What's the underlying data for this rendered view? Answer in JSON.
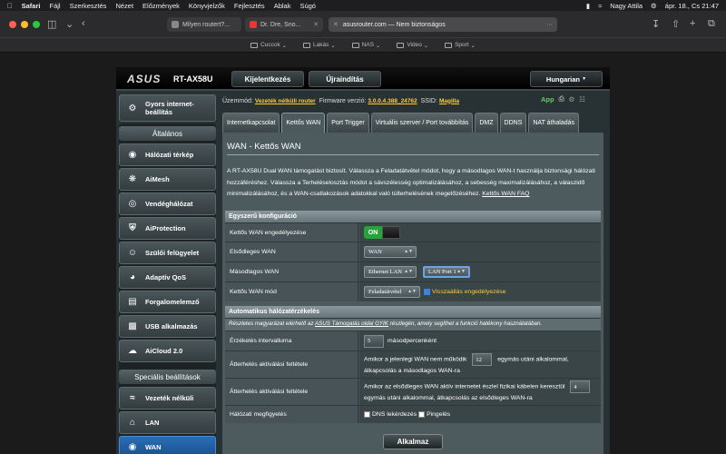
{
  "menubar": {
    "app": "Safari",
    "items": [
      "Fájl",
      "Szerkesztés",
      "Nézet",
      "Előzmények",
      "Könyvjelzők",
      "Fejlesztés",
      "Ablak",
      "Súgó"
    ],
    "user": "Nagy Attila",
    "datetime": "ápr. 18., Cs 21:47"
  },
  "browser": {
    "tabs": [
      {
        "title": "Milyen routert?..."
      },
      {
        "title": "Dr. Dre, Sno..."
      },
      {
        "title": "asusrouter.com — Nem biztonságos"
      }
    ],
    "bookmarks": [
      "Cuccok",
      "Lakás",
      "NAS",
      "Video",
      "Sport"
    ]
  },
  "router": {
    "logo": "ASUS",
    "model": "RT-AX58U",
    "logout_label": "Kijelentkezés",
    "reboot_label": "Újraindítás",
    "language": "Hungarian",
    "quick_setup_label": "Gyors internet-beállítás",
    "general_header": "Általános",
    "general_items": [
      {
        "label": "Hálózati térkép"
      },
      {
        "label": "AiMesh"
      },
      {
        "label": "Vendéghálózat"
      },
      {
        "label": "AiProtection"
      },
      {
        "label": "Szülői felügyelet"
      },
      {
        "label": "Adaptív QoS"
      },
      {
        "label": "Forgalomelemző"
      },
      {
        "label": "USB alkalmazás"
      },
      {
        "label": "AiCloud 2.0"
      }
    ],
    "advanced_header": "Speciális beállítások",
    "advanced_items": [
      {
        "label": "Vezeték nélküli"
      },
      {
        "label": "LAN"
      },
      {
        "label": "WAN"
      }
    ],
    "info": {
      "mode_label": "Üzemmód:",
      "mode_value": "Vezeték nélküli router",
      "firmware_label": "Firmware verzió:",
      "firmware_value": "3.0.0.4.388_24762",
      "ssid_label": "SSID:",
      "ssid_value": "Magilla",
      "app_label": "App"
    },
    "tabs": [
      "Internetkapcsolat",
      "Kettős WAN",
      "Port Trigger",
      "Virtuális szerver / Port továbbítás",
      "DMZ",
      "DDNS",
      "NAT áthaladás"
    ],
    "page_title": "WAN - Kettős WAN",
    "description": "A RT-AX58U Dual WAN támogatást biztosít. Válassza a Feladatátvétel módot, hogy a másodlagos WAN-t használja biztonsági hálózati hozzáféréshez. Válassza a Terheléselosztás módot a sávszélesség optimalizálásához, a sebesség maximalizálásához, a válaszidő minimalizálásához, és a WAN-csatlakozások adatokkal való túlterhelésének megelőzéséhez.",
    "faq_link": "Kettős WAN FAQ",
    "basic_section": "Egyszerű konfiguráció",
    "enable_label": "Kettős WAN engedélyezése",
    "enable_value": "ON",
    "primary_label": "Elsődleges WAN",
    "primary_value": "WAN",
    "secondary_label": "Másodlagos WAN",
    "secondary_value": "Ethernet LAN",
    "secondary_port": "LAN Port 1",
    "mode_row_label": "Kettős WAN mód",
    "mode_row_value": "Feladatátvétel",
    "fallback_label": "Visszaállás engedélyezése",
    "auto_section": "Automatikus hálózatérzékelés",
    "auto_note_prefix": "Részletes magyarázat elérhető az",
    "auto_note_link": "ASUS Támogatás oldal GYIK",
    "auto_note_suffix": "részlegén, amely segíthet a funkció hatékony használatában.",
    "interval_label": "Érzékelés intervalluma",
    "interval_value": "5",
    "interval_unit": "másodpercenként",
    "failover_label": "Átterhelés aktiválási feltétele",
    "failover_pre": "Amikor a jelenlegi WAN nem működik",
    "failover_value": "12",
    "failover_post": "egymás utáni alkalommal, átkapcsolás a másodlagos WAN-ra",
    "failback_label": "Átterhelés aktiválási feltétele",
    "failback_pre": "Amikor az elsődleges WAN aktív internetet észlel fizikai kábelen keresztül",
    "failback_value": "4",
    "failback_post": "egymás utáni alkalommal, átkapcsolás az elsődleges WAN-ra",
    "monitor_label": "Hálózati megfigyelés",
    "dns_label": "DNS lekérdezés",
    "ping_label": "Pingelés",
    "apply_label": "Alkalmaz"
  }
}
